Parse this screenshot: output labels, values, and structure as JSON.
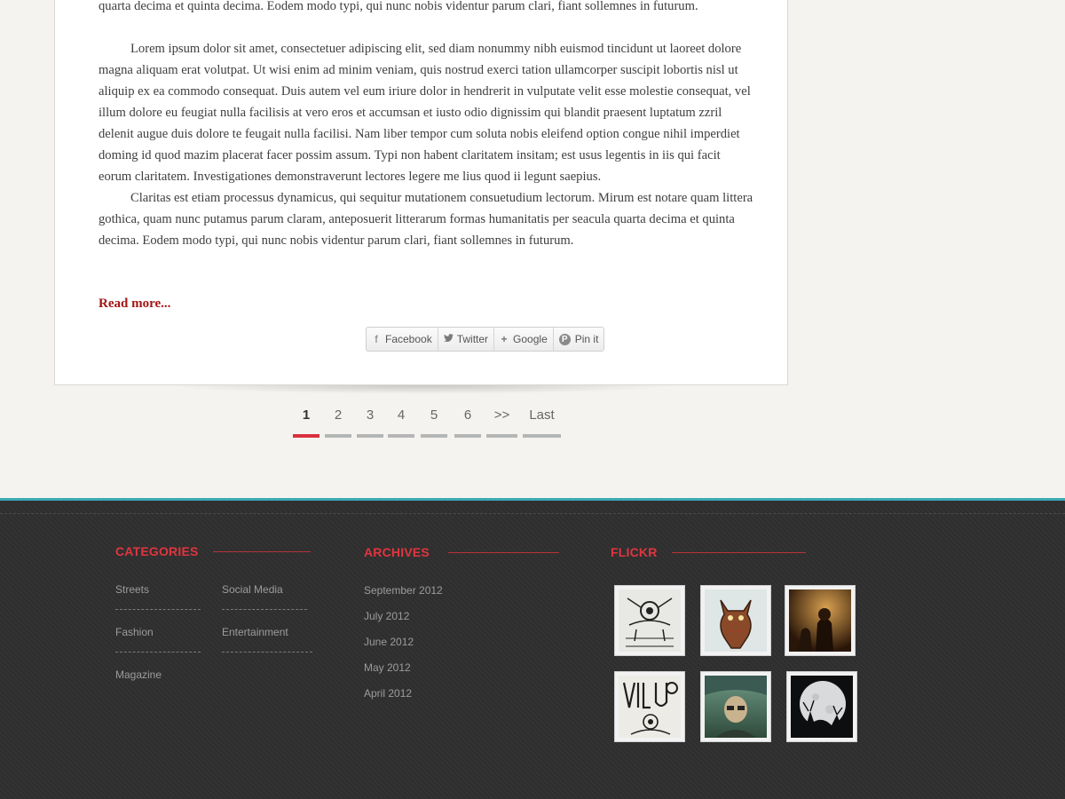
{
  "article": {
    "paragraph_1_tail": "quarta decima et quinta decima. Eodem modo typi, qui nunc nobis videntur parum clari, fiant sollemnes in futurum.",
    "paragraph_2": "Lorem ipsum dolor sit amet, consectetuer adipiscing elit, sed diam nonummy nibh euismod tincidunt ut laoreet dolore magna aliquam erat volutpat. Ut wisi enim ad minim veniam, quis nostrud exerci tation ullamcorper suscipit lobortis nisl ut aliquip ex ea commodo consequat. Duis autem vel eum iriure dolor in hendrerit in vulputate velit esse molestie consequat, vel illum dolore eu feugiat nulla facilisis at vero eros et accumsan et iusto odio dignissim qui blandit praesent luptatum zzril delenit augue duis dolore te feugait nulla facilisi. Nam liber tempor cum soluta nobis eleifend option congue nihil imperdiet doming id quod mazim placerat facer possim assum. Typi non habent claritatem insitam; est usus legentis in iis qui facit eorum claritatem. Investigationes demonstraverunt lectores legere me lius quod ii legunt saepius.",
    "paragraph_3": "Claritas est etiam processus dynamicus, qui sequitur mutationem consuetudium lectorum. Mirum est notare quam littera gothica, quam nunc putamus parum claram, anteposuerit litterarum formas humanitatis per seacula quarta decima et quinta decima. Eodem modo typi, qui nunc nobis videntur parum clari, fiant sollemnes in futurum.",
    "read_more": "Read more..."
  },
  "share": {
    "facebook": "Facebook",
    "twitter": "Twitter",
    "google": "Google",
    "pinterest": "Pin it"
  },
  "pagination": {
    "pages": [
      "1",
      "2",
      "3",
      "4",
      "5",
      "6",
      ">>",
      "Last"
    ],
    "active": "1"
  },
  "footer": {
    "categories": {
      "title": "Categories",
      "items": [
        "Streets",
        "Social Media",
        "Fashion",
        "Entertainment",
        "Magazine"
      ]
    },
    "archives": {
      "title": "Archives",
      "items": [
        "September 2012",
        "July 2012",
        "June 2012",
        "May 2012",
        "April 2012"
      ]
    },
    "flickr": {
      "title": "Flickr"
    }
  },
  "colors": {
    "accent_red": "#d9313e",
    "footer_bg": "#2f2f2f",
    "footer_top_border": "#3aa8b4",
    "read_more": "#a31515"
  }
}
